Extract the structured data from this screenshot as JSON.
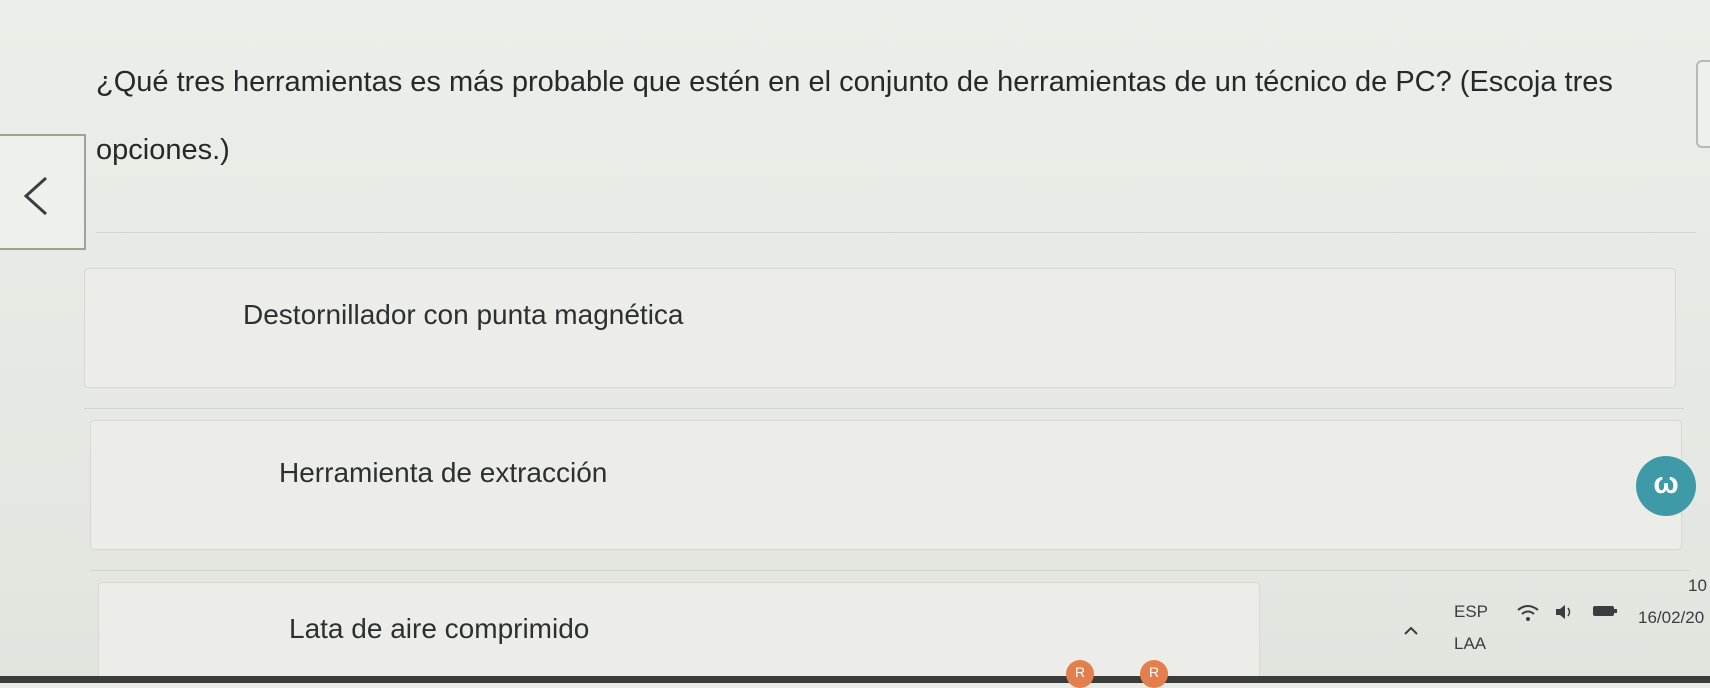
{
  "question": {
    "text": "¿Qué tres herramientas es más probable que estén en el conjunto de herramientas de un técnico de PC? (Escoja tres opciones.)"
  },
  "options": [
    {
      "label": "Destornillador con punta magnética"
    },
    {
      "label": "Herramienta de extracción"
    },
    {
      "label": "Lata de aire comprimido"
    }
  ],
  "taskbar": {
    "language_top": "ESP",
    "language_bottom": "LAA",
    "time": "10",
    "date": "16/02/20",
    "app_letter_1": "R",
    "app_letter_2": "R"
  },
  "icons": {
    "back": "chevron-left-icon",
    "floating_app": "teal-app-icon",
    "wifi": "wifi-icon",
    "volume": "volume-icon",
    "battery": "battery-icon",
    "tray_expand": "chevron-up-icon"
  },
  "colors": {
    "background": "#e9ebe6",
    "teal_accent": "#3f9aa8",
    "app_orange": "#e27f4d"
  }
}
